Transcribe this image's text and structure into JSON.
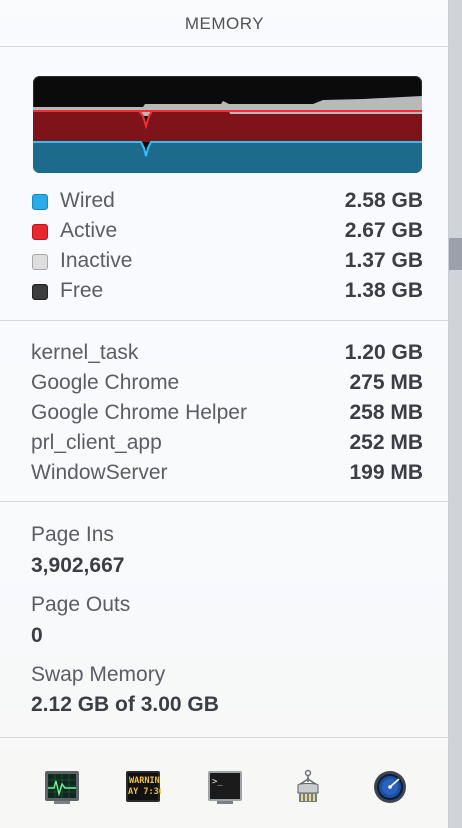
{
  "header": {
    "title": "MEMORY"
  },
  "graph": {
    "colors": {
      "wired": "#2aa7e0",
      "active": "#e0252a",
      "inactive": "#bdbdbd",
      "free": "#3a3a3a"
    }
  },
  "legend": [
    {
      "label": "Wired",
      "value": "2.58 GB",
      "color": "#29abe8"
    },
    {
      "label": "Active",
      "value": "2.67 GB",
      "color": "#e7262e"
    },
    {
      "label": "Inactive",
      "value": "1.37 GB",
      "color": "#dedede"
    },
    {
      "label": "Free",
      "value": "1.38 GB",
      "color": "#3c3c3c"
    }
  ],
  "processes": [
    {
      "name": "kernel_task",
      "value": "1.20 GB"
    },
    {
      "name": "Google Chrome",
      "value": "275 MB"
    },
    {
      "name": "Google Chrome Helper",
      "value": "258 MB"
    },
    {
      "name": "prl_client_app",
      "value": "252 MB"
    },
    {
      "name": "WindowServer",
      "value": "199 MB"
    }
  ],
  "stats": {
    "page_ins_label": "Page Ins",
    "page_ins_value": "3,902,667",
    "page_outs_label": "Page Outs",
    "page_outs_value": "0",
    "swap_label": "Swap Memory",
    "swap_value": "2.12 GB of 3.00 GB"
  },
  "toolbar": {
    "console_text_1": "WARNIN",
    "console_text_2": "AY 7:36",
    "terminal_text": ">_"
  },
  "icons": [
    "activity-monitor-icon",
    "console-icon",
    "terminal-icon",
    "disk-utility-icon",
    "network-utility-icon"
  ]
}
